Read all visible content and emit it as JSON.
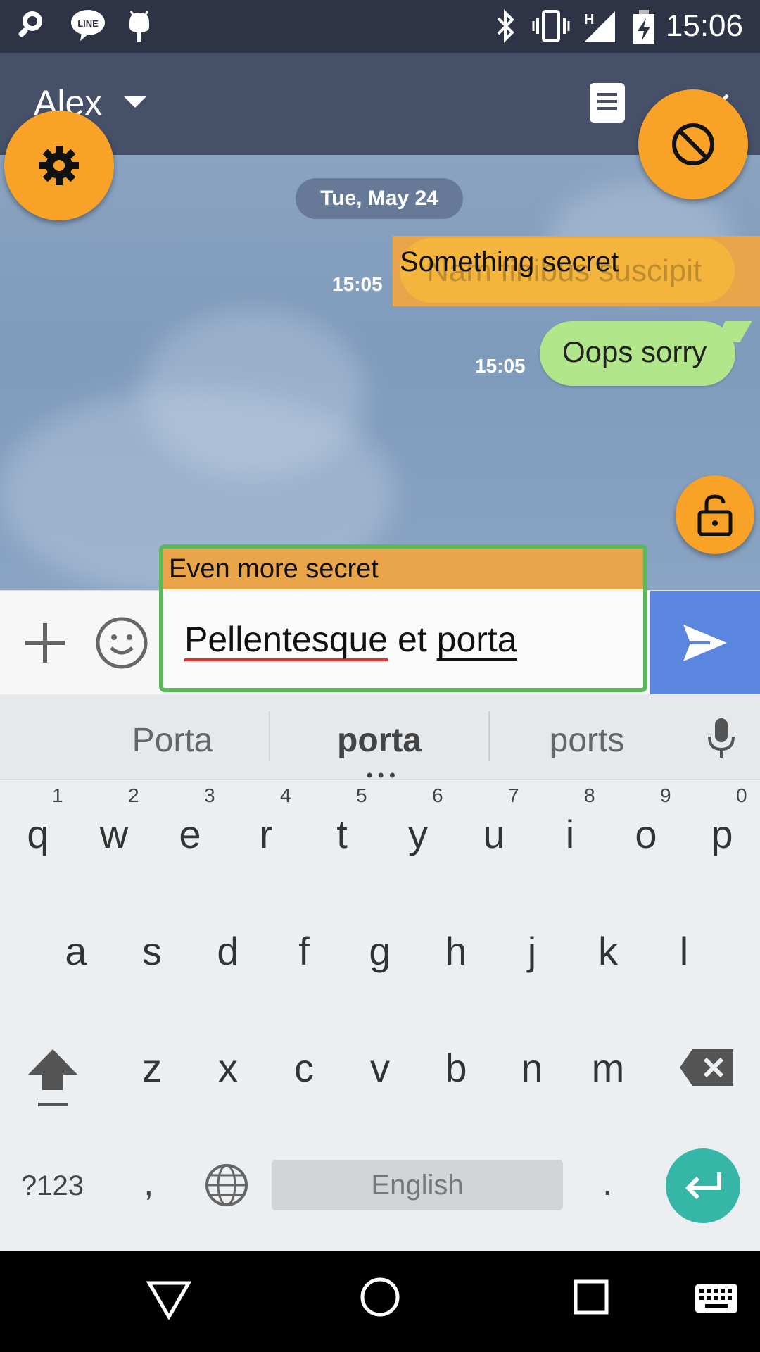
{
  "status_bar": {
    "time": "15:06",
    "icons": [
      "magnifier-chat-icon",
      "line-app-icon",
      "android-debug-icon",
      "bluetooth-icon",
      "vibrate-icon",
      "signal-h-icon",
      "battery-charging-icon"
    ],
    "network_type": "H"
  },
  "app_bar": {
    "chat_name": "Alex",
    "icons": [
      "dropdown-caret-icon",
      "notes-icon",
      "more-icon"
    ]
  },
  "chat": {
    "date_divider": "Tue, May 24",
    "messages": [
      {
        "time": "15:05",
        "text": "Nam finibus suscipit",
        "overlay_label": "Something secret"
      },
      {
        "time": "15:05",
        "text": "Oops sorry"
      }
    ]
  },
  "overlay_buttons": {
    "settings_icon": "gear-icon",
    "block_icon": "prohibited-icon",
    "lock_icon": "unlocked-padlock-icon"
  },
  "composer": {
    "secret_label": "Even more secret",
    "input_words": [
      "Pellentesque",
      "et",
      "porta"
    ],
    "icons": [
      "plus-icon",
      "smiley-icon",
      "send-icon"
    ]
  },
  "keyboard": {
    "suggestions": [
      "Porta",
      "porta",
      "ports"
    ],
    "row1": [
      "q",
      "w",
      "e",
      "r",
      "t",
      "y",
      "u",
      "i",
      "o",
      "p"
    ],
    "row1_hints": [
      "1",
      "2",
      "3",
      "4",
      "5",
      "6",
      "7",
      "8",
      "9",
      "0"
    ],
    "row2": [
      "a",
      "s",
      "d",
      "f",
      "g",
      "h",
      "j",
      "k",
      "l"
    ],
    "row3": [
      "z",
      "x",
      "c",
      "v",
      "b",
      "n",
      "m"
    ],
    "symbols_key": "?123",
    "comma_key": ",",
    "space_label": "English",
    "period_key": "."
  },
  "colors": {
    "accent_orange": "#f8a327",
    "send_blue": "#5b86e0",
    "sent_bubble": "#b1e78a",
    "enter_teal": "#35b6a6",
    "highlight_green": "#5cb85c"
  }
}
